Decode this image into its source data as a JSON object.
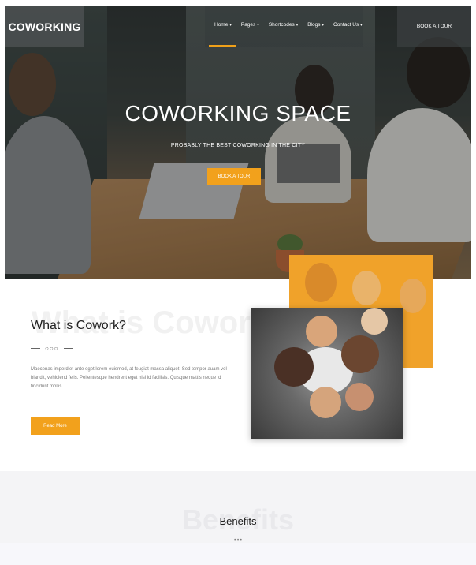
{
  "brand": {
    "logo": "COWORKING"
  },
  "nav": {
    "items": [
      {
        "label": "Home",
        "icon": "chevron-down-icon"
      },
      {
        "label": "Pages",
        "icon": "chevron-down-icon"
      },
      {
        "label": "Shortcodes",
        "icon": "chevron-down-icon"
      },
      {
        "label": "Blogs",
        "icon": "chevron-down-icon"
      },
      {
        "label": "Contact Us",
        "icon": "chevron-down-icon"
      }
    ],
    "cta": "BOOK A TOUR"
  },
  "hero": {
    "title": "COWORKING SPACE",
    "subtitle": "PROBABLY THE BEST COWORKING IN THE CITY",
    "button": "BOOK A TOUR"
  },
  "about": {
    "ghost": "What is Cowork?",
    "title": "What is Cowork?",
    "divider": "○○○",
    "body": "Maecenas imperdiet ante eget lorem euismod, at feugiat massa aliquet. Sed tempor auam vel blandit, vehiclend felis. Pellentesque hendrerit eget nisl id facilisis. Quisque mattis neque id tincidunt mollis.",
    "button": "Read More"
  },
  "benefits": {
    "ghost": "Benefits",
    "title": "Benefits",
    "divider": "• • •"
  },
  "colors": {
    "accent": "#f2a11c",
    "dark": "#222222",
    "light_bg": "#f4f4f6"
  }
}
